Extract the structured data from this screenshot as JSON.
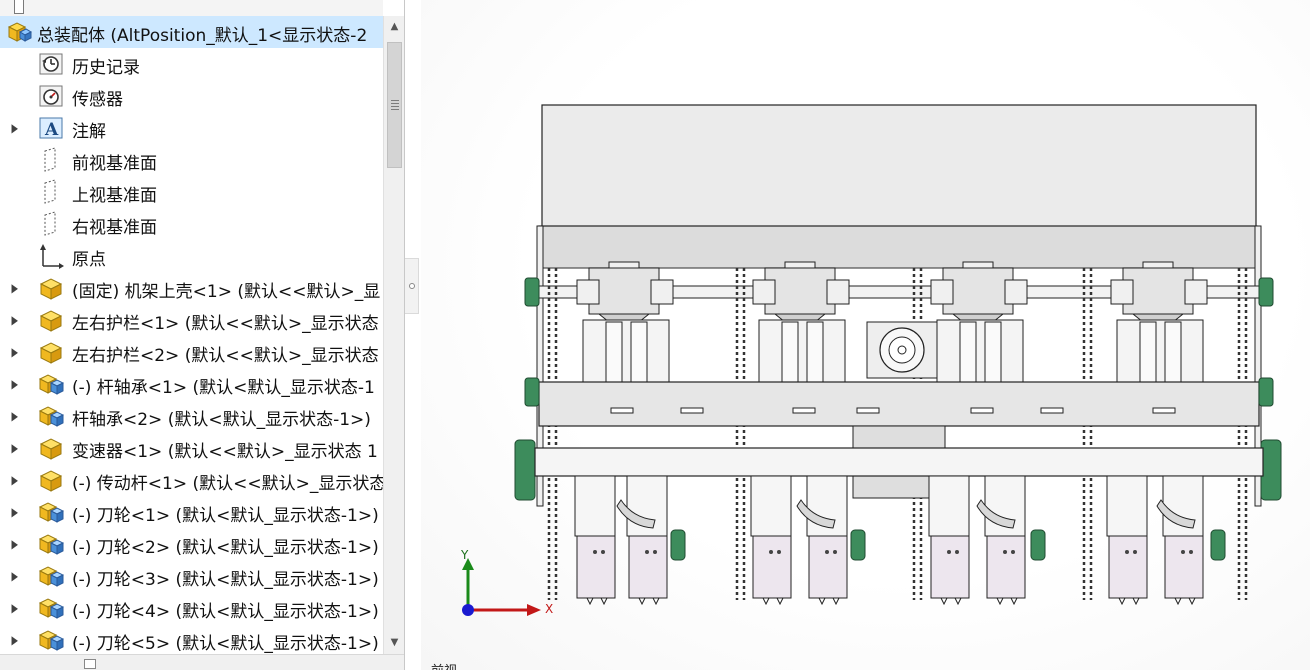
{
  "tree": {
    "root": {
      "label": "总装配体 (AltPosition_默认_1<显示状态-2"
    },
    "items": [
      {
        "label": "历史记录",
        "icon": "history-icon",
        "expandable": false
      },
      {
        "label": "传感器",
        "icon": "sensor-icon",
        "expandable": false
      },
      {
        "label": "注解",
        "icon": "annotation-icon",
        "expandable": true
      },
      {
        "label": "前视基准面",
        "icon": "plane-icon",
        "expandable": false
      },
      {
        "label": "上视基准面",
        "icon": "plane-icon",
        "expandable": false
      },
      {
        "label": "右视基准面",
        "icon": "plane-icon",
        "expandable": false
      },
      {
        "label": "原点",
        "icon": "origin-icon",
        "expandable": false
      },
      {
        "label": "(固定) 机架上壳<1> (默认<<默认>_显",
        "icon": "part-icon",
        "expandable": true
      },
      {
        "label": "左右护栏<1> (默认<<默认>_显示状态",
        "icon": "part-icon",
        "expandable": true
      },
      {
        "label": "左右护栏<2> (默认<<默认>_显示状态",
        "icon": "part-icon",
        "expandable": true
      },
      {
        "label": "(-) 杆轴承<1> (默认<默认_显示状态-1",
        "icon": "subassembly-icon",
        "expandable": true
      },
      {
        "label": "杆轴承<2> (默认<默认_显示状态-1>)",
        "icon": "subassembly-icon",
        "expandable": true
      },
      {
        "label": "变速器<1> (默认<<默认>_显示状态 1",
        "icon": "part-icon",
        "expandable": true
      },
      {
        "label": "(-) 传动杆<1> (默认<<默认>_显示状态",
        "icon": "part-icon",
        "expandable": true
      },
      {
        "label": "(-) 刀轮<1> (默认<默认_显示状态-1>)",
        "icon": "subassembly-icon",
        "expandable": true
      },
      {
        "label": "(-) 刀轮<2> (默认<默认_显示状态-1>)",
        "icon": "subassembly-icon",
        "expandable": true
      },
      {
        "label": "(-) 刀轮<3> (默认<默认_显示状态-1>)",
        "icon": "subassembly-icon",
        "expandable": true
      },
      {
        "label": "(-) 刀轮<4> (默认<默认_显示状态-1>)",
        "icon": "subassembly-icon",
        "expandable": true
      },
      {
        "label": "(-) 刀轮<5> (默认<默认_显示状态-1>)",
        "icon": "subassembly-icon",
        "expandable": true
      }
    ]
  },
  "triad": {
    "x_label": "X",
    "y_label": "Y"
  },
  "graphics": {
    "bottom_tab_label": "前视"
  },
  "colors": {
    "selection": "#cde8ff",
    "accent_green": "#3d8c5c",
    "axis_x": "#c21818",
    "axis_y": "#1a6f1a",
    "axis_z": "#1a1ad0"
  }
}
